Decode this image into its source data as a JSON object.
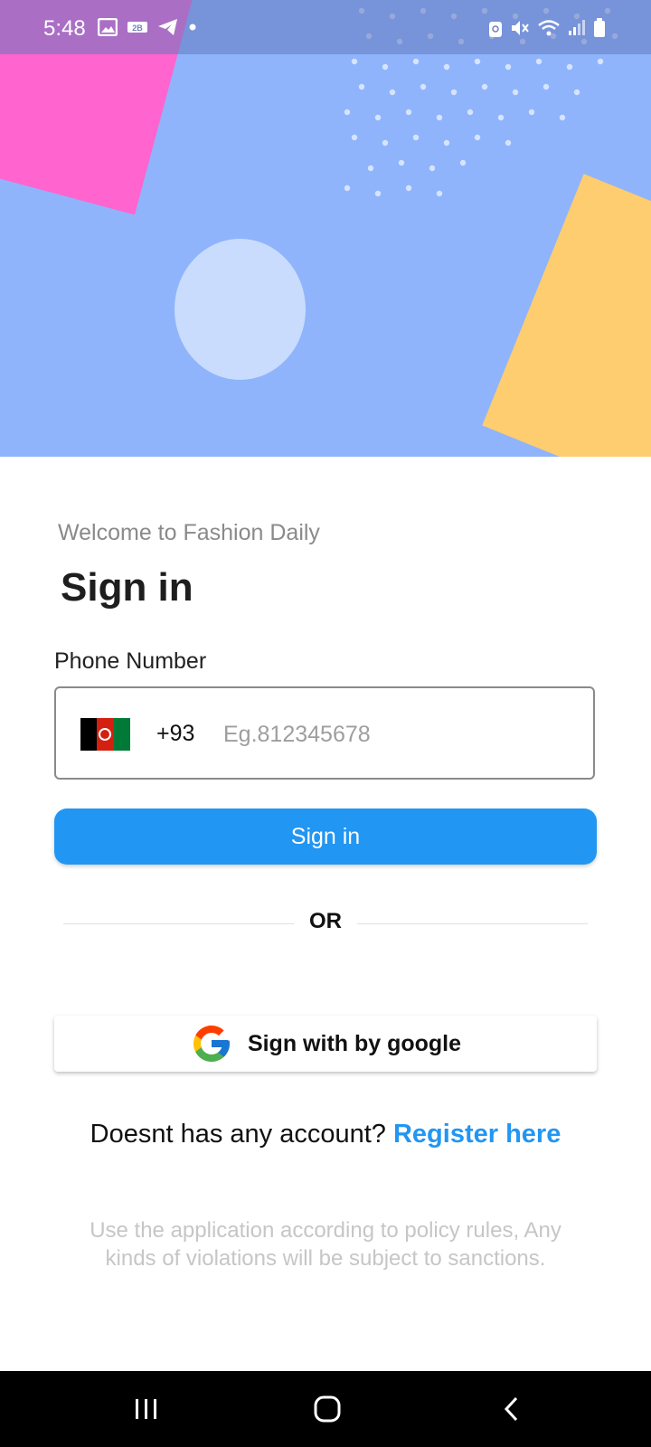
{
  "status_bar": {
    "time": "5:48",
    "left_icons": [
      "gallery-icon",
      "sim-badge-icon",
      "telegram-icon",
      "notification-dot-icon"
    ],
    "right_icons": [
      "alarm-icon",
      "mute-icon",
      "wifi-icon",
      "signal-icon",
      "battery-icon"
    ]
  },
  "colors": {
    "hero_background": "#8fb4fb",
    "hero_pink": "#ff64cf",
    "hero_yellow": "#fdcd6f",
    "accent": "#2196f3"
  },
  "form": {
    "welcome_text": "Welcome to Fashion Daily",
    "title": "Sign in",
    "phone_label": "Phone Number",
    "country_flag": "afghanistan-flag-icon",
    "dial_code": "+93",
    "phone_value": "",
    "phone_placeholder": "Eg.812345678",
    "signin_button_label": "Sign in",
    "or_text": "OR",
    "google_button_label": "Sign with by google",
    "register_prompt": "Doesnt has any account? ",
    "register_link": "Register here",
    "policy_text": "Use the application according to policy rules, Any kinds of violations will be subject to sanctions."
  },
  "nav_bar": {
    "buttons": [
      "recent-apps-icon",
      "home-icon",
      "back-icon"
    ]
  }
}
